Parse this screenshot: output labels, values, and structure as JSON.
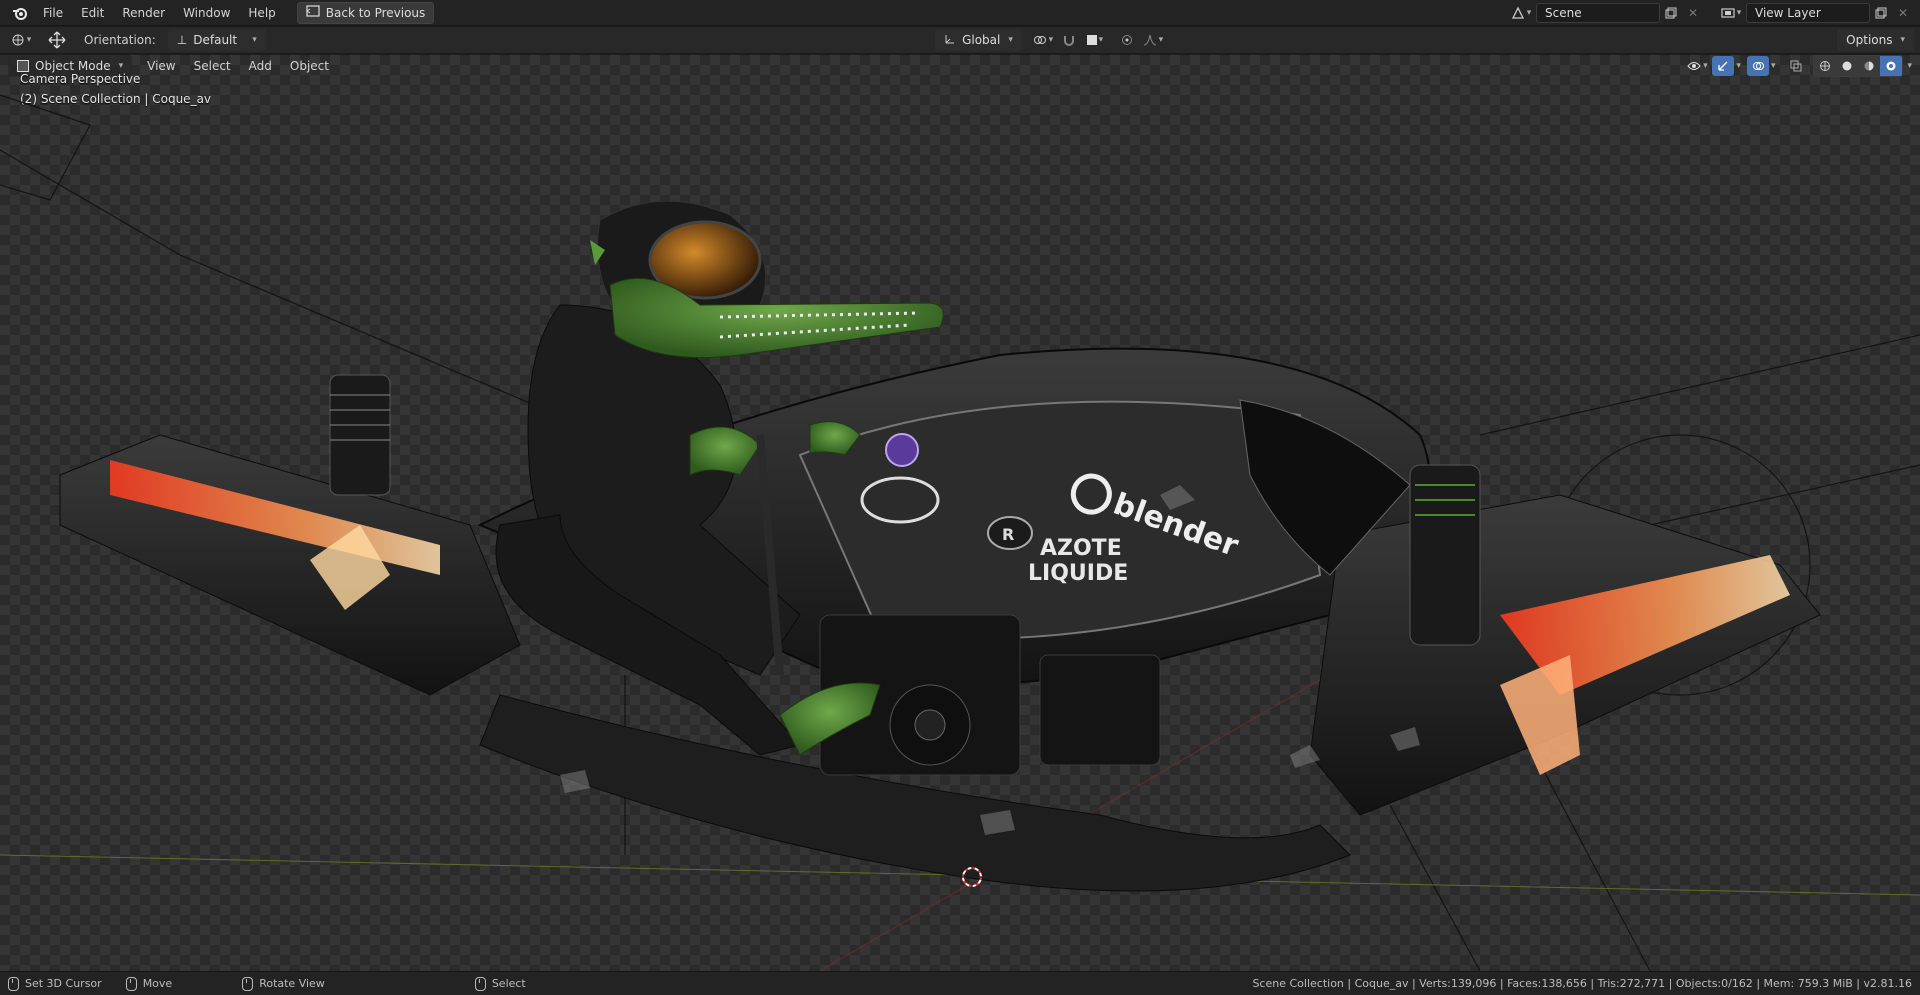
{
  "topbar": {
    "menus": [
      "File",
      "Edit",
      "Render",
      "Window",
      "Help"
    ],
    "back_button": "Back to Previous",
    "scene_name": "Scene",
    "view_layer_name": "View Layer"
  },
  "toolbar": {
    "orientation_label": "Orientation:",
    "orientation_value": "Default",
    "transform_orientation": "Global",
    "options_label": "Options"
  },
  "header": {
    "mode": "Object Mode",
    "menus": [
      "View",
      "Select",
      "Add",
      "Object"
    ]
  },
  "viewport": {
    "view_name": "Camera Perspective",
    "collection_info": "(2) Scene Collection | Coque_av",
    "decals": {
      "azote": "AZOTE",
      "liquide": "LIQUIDE",
      "blender": "blender",
      "r": "R"
    }
  },
  "statusbar": {
    "set_cursor": "Set 3D Cursor",
    "move": "Move",
    "rotate": "Rotate View",
    "select": "Select",
    "stats": "Scene Collection | Coque_av | Verts:139,096 | Faces:138,656 | Tris:272,771 | Objects:0/162 | Mem: 759.3 MiB | v2.81.16"
  },
  "colors": {
    "accent": "#4772b3",
    "header_bg": "#232323",
    "viewport_checker": "#353535",
    "orange_glow": "#ff7a3a",
    "green_skin": "#3f7a2b"
  },
  "icons": {
    "app": "blender-logo-icon",
    "back": "back-to-previous-icon",
    "scene": "scene-icon",
    "view_layer": "view-layer-icon"
  }
}
